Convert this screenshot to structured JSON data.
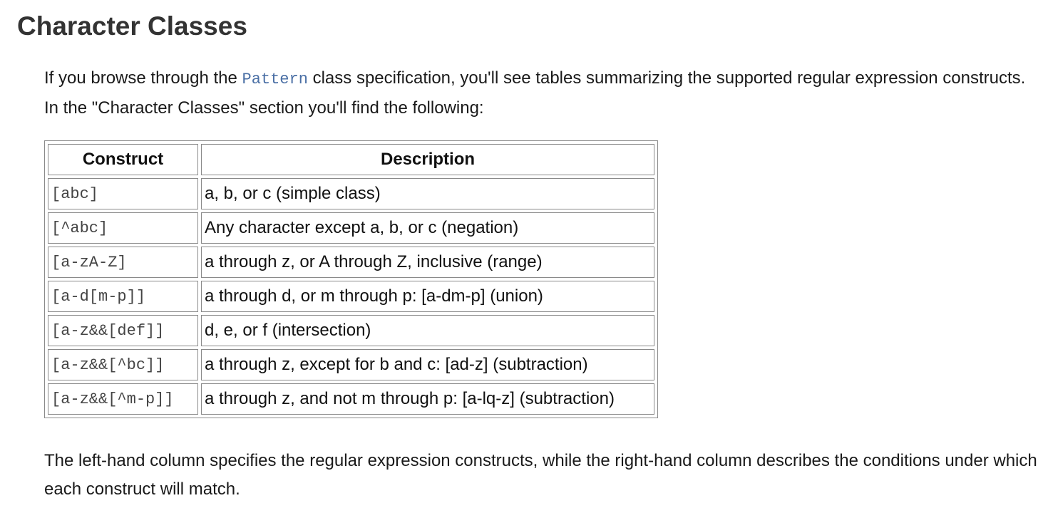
{
  "page": {
    "title": "Character Classes"
  },
  "intro": {
    "before_code": "If you browse through the ",
    "code": "Pattern",
    "after_code": " class specification, you'll see tables summarizing the supported regular expression constructs. In the \"Character Classes\" section you'll find the following:"
  },
  "table": {
    "headers": {
      "construct": "Construct",
      "description": "Description"
    },
    "rows": [
      {
        "construct": "[abc]",
        "description": "a, b, or c (simple class)"
      },
      {
        "construct": "[^abc]",
        "description": "Any character except a, b, or c (negation)"
      },
      {
        "construct": "[a-zA-Z]",
        "description": "a through z, or A through Z, inclusive (range)"
      },
      {
        "construct": "[a-d[m-p]]",
        "description": "a through d, or m through p: [a-dm-p] (union)"
      },
      {
        "construct": "[a-z&&[def]]",
        "description": "d, e, or f (intersection)"
      },
      {
        "construct": "[a-z&&[^bc]]",
        "description": "a through z, except for b and c: [ad-z] (subtraction)"
      },
      {
        "construct": "[a-z&&[^m-p]]",
        "description": "a through z, and not m through p: [a-lq-z] (subtraction)"
      }
    ]
  },
  "outro": {
    "text": "The left-hand column specifies the regular expression constructs, while the right-hand column describes the conditions under which each construct will match."
  }
}
